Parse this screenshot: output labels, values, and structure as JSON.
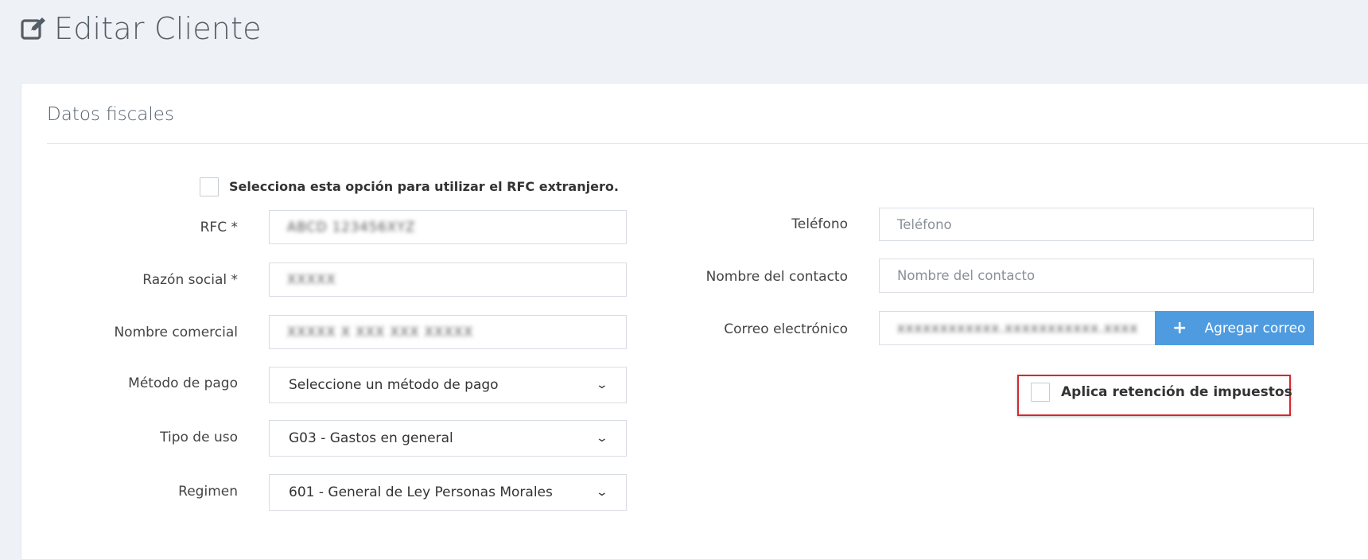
{
  "header": {
    "title": "Editar Cliente",
    "icon": "edit-icon"
  },
  "section": {
    "title": "Datos fiscales"
  },
  "foreign_rfc": {
    "label": "Selecciona esta opción para utilizar el RFC extranjero.",
    "checked": false
  },
  "left_fields": {
    "rfc": {
      "label": "RFC *",
      "value": "ABCD 123456XYZ"
    },
    "razon_social": {
      "label": "Razón social *",
      "value": "XXXXX"
    },
    "nombre_comercial": {
      "label": "Nombre comercial",
      "value": "XXXXX X XXX XXX XXXXX"
    },
    "metodo_pago": {
      "label": "Método de pago",
      "value": "Seleccione un método de pago"
    },
    "tipo_uso": {
      "label": "Tipo de uso",
      "value": "G03 - Gastos en general"
    },
    "regimen": {
      "label": "Regimen",
      "value": "601 - General de Ley Personas Morales"
    }
  },
  "right_fields": {
    "telefono": {
      "label": "Teléfono",
      "placeholder": "Teléfono"
    },
    "contacto": {
      "label": "Nombre del contacto",
      "placeholder": "Nombre del contacto"
    },
    "correo": {
      "label": "Correo electrónico",
      "value": "xxxxxxxxxxxx.xxxxxxxxxxx.xxxx"
    },
    "add_email_button": "Agregar correo"
  },
  "retention": {
    "label": "Aplica retención de impuestos",
    "checked": false
  },
  "colors": {
    "accent": "#4e9be0",
    "highlight": "#d6282f",
    "background": "#eef1f5"
  }
}
